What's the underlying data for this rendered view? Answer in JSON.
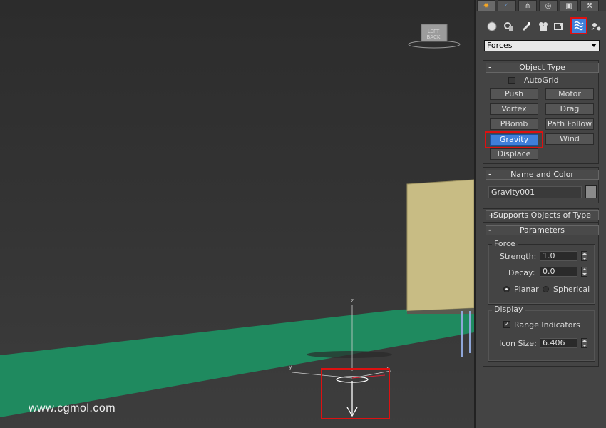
{
  "command_panel": {
    "tabs": [
      {
        "icon": "create-icon",
        "glyph": "✹"
      },
      {
        "icon": "modify-icon",
        "glyph": "◜"
      },
      {
        "icon": "hierarchy-icon",
        "glyph": "⋔"
      },
      {
        "icon": "motion-icon",
        "glyph": "◎"
      },
      {
        "icon": "display-icon",
        "glyph": "▣"
      },
      {
        "icon": "utilities-icon",
        "glyph": "⚒"
      }
    ],
    "categories": [
      {
        "icon": "geometry-icon"
      },
      {
        "icon": "shapes-icon"
      },
      {
        "icon": "lights-icon"
      },
      {
        "icon": "cameras-icon"
      },
      {
        "icon": "helpers-icon"
      },
      {
        "icon": "space-warps-icon"
      },
      {
        "icon": "systems-icon"
      }
    ],
    "subcategory_selected": "Forces",
    "object_type": {
      "title": "Object Type",
      "collapse_sign": "-",
      "autogrid_label": "AutoGrid",
      "buttons": [
        "Push",
        "Motor",
        "Vortex",
        "Drag",
        "PBomb",
        "Path Follow",
        "Gravity",
        "Wind",
        "Displace"
      ],
      "active_button": "Gravity"
    },
    "name_and_color": {
      "title": "Name and Color",
      "collapse_sign": "-",
      "name_value": "Gravity001",
      "swatch_color": "#8a8a8a"
    },
    "supports": {
      "title": "Supports Objects of Type",
      "collapse_sign": "+"
    },
    "parameters": {
      "title": "Parameters",
      "collapse_sign": "-",
      "force_group": "Force",
      "strength_label": "Strength:",
      "strength_value": "1.0",
      "decay_label": "Decay:",
      "decay_value": "0.0",
      "planar_label": "Planar",
      "spherical_label": "Spherical",
      "selected_mode": "Planar",
      "display_group": "Display",
      "range_label": "Range Indicators",
      "range_checked": true,
      "iconsize_label": "Icon Size:",
      "iconsize_value": "6.406"
    }
  },
  "viewport": {
    "view_cube_label": "LEFT  BACK",
    "axis_z": "z",
    "axis_y": "y",
    "axis_x": "x",
    "watermark": "www.cgmol.com",
    "colors": {
      "floor": "#1f8a5f",
      "wall": "#c8bc84",
      "highlight": "#dd1111",
      "active_button": "#3f7fd9"
    }
  }
}
